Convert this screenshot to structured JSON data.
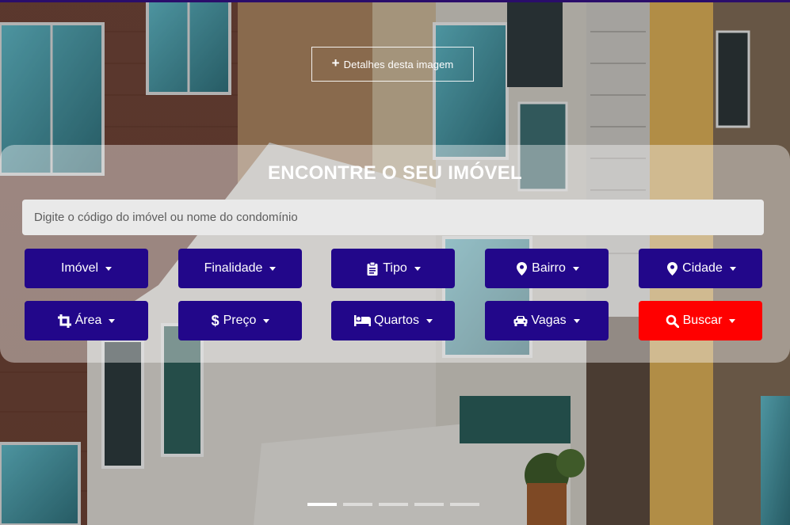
{
  "hero": {
    "details_button_label": "Detalhes desta imagem"
  },
  "search": {
    "title": "ENCONTRE O SEU IMÓVEL",
    "input_placeholder": "Digite o código do imóvel ou nome do condomínio",
    "input_value": ""
  },
  "filters": {
    "row1": [
      {
        "label": "Imóvel",
        "icon": "none"
      },
      {
        "label": "Finalidade",
        "icon": "none"
      },
      {
        "label": "Tipo",
        "icon": "clipboard-icon"
      },
      {
        "label": "Bairro",
        "icon": "map-marker-icon"
      },
      {
        "label": "Cidade",
        "icon": "map-marker-icon"
      }
    ],
    "row2": [
      {
        "label": "Área",
        "icon": "crop-icon"
      },
      {
        "label": "Preço",
        "icon": "dollar-icon"
      },
      {
        "label": "Quartos",
        "icon": "bed-icon"
      },
      {
        "label": "Vagas",
        "icon": "car-icon"
      },
      {
        "label": "Buscar",
        "icon": "search-icon"
      }
    ]
  },
  "slider": {
    "slide_count": 5,
    "active_index": 0
  },
  "colors": {
    "button_primary": "#22078a",
    "button_search": "#ff0000",
    "top_strip": "#2a0d6b"
  }
}
